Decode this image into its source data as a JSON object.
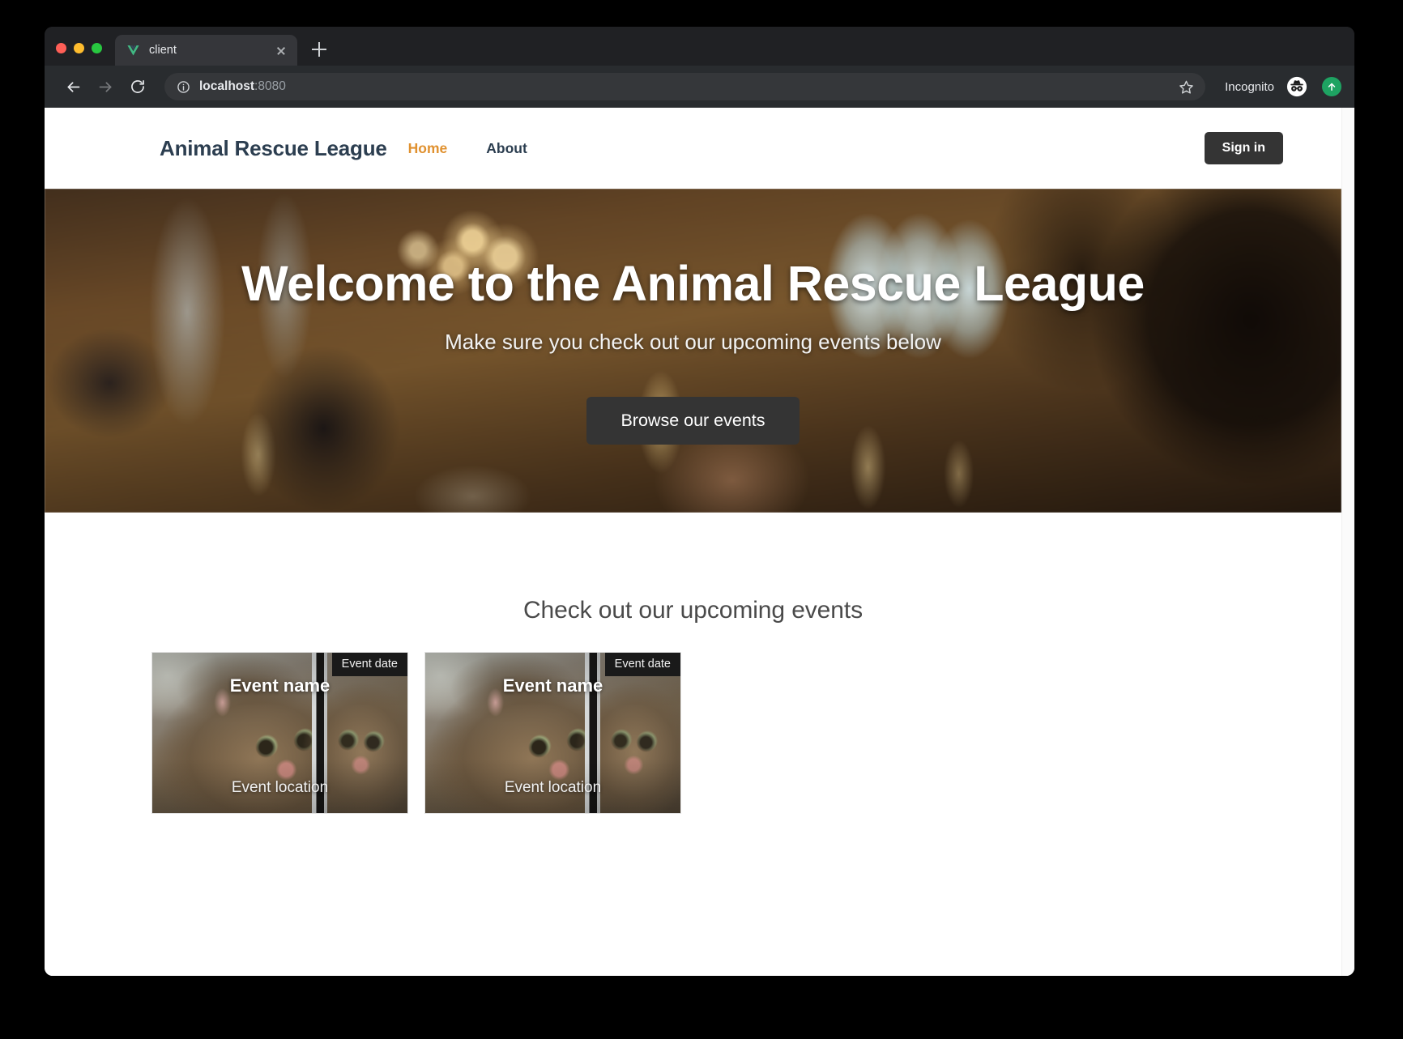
{
  "browser": {
    "tab": {
      "title": "client",
      "favicon": "vue-logo-icon",
      "close_icon": "close-icon"
    },
    "new_tab_icon": "plus-icon",
    "toolbar": {
      "back_icon": "back-arrow-icon",
      "forward_icon": "forward-arrow-icon",
      "reload_icon": "reload-icon",
      "info_icon": "info-circle-icon",
      "url_host": "localhost",
      "url_port": ":8080",
      "star_icon": "bookmark-star-icon",
      "incognito_label": "Incognito",
      "incognito_icon": "incognito-hat-icon",
      "profile_icon": "profile-avatar-icon"
    },
    "traffic_lights": [
      "close",
      "minimize",
      "maximize"
    ]
  },
  "site": {
    "header": {
      "brand": "Animal Rescue League",
      "nav": [
        {
          "label": "Home",
          "active": true
        },
        {
          "label": "About",
          "active": false
        }
      ],
      "signin_label": "Sign in"
    },
    "hero": {
      "title": "Welcome to the Animal Rescue League",
      "subtitle": "Make sure you check out our upcoming events below",
      "cta_label": "Browse our events",
      "background": "celebration-toast-photo"
    },
    "events": {
      "heading": "Check out our upcoming events",
      "cards": [
        {
          "date_badge": "Event date",
          "name": "Event name",
          "location": "Event location",
          "image": "kitten-photo"
        },
        {
          "date_badge": "Event date",
          "name": "Event name",
          "location": "Event location",
          "image": "kitten-photo"
        }
      ]
    }
  },
  "colors": {
    "brand_navy": "#2c3e50",
    "accent_orange": "#e0912f",
    "button_dark": "#343434",
    "browser_chrome": "#292c2f",
    "tab_strip": "#202124"
  }
}
